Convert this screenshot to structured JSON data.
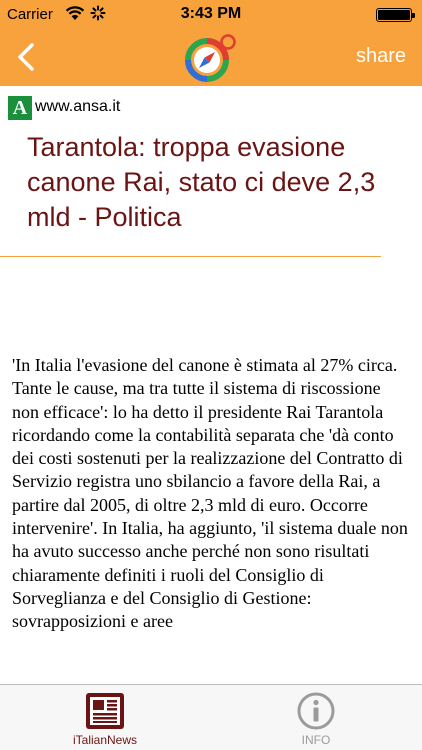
{
  "status_bar": {
    "carrier": "Carrier",
    "time": "3:43 PM"
  },
  "nav": {
    "share_label": "share"
  },
  "source": {
    "mark": "A",
    "url": "www.ansa.it"
  },
  "article": {
    "title": "Tarantola: troppa evasione canone Rai, stato ci deve 2,3 mld - Politica",
    "body": " 'In Italia l'evasione del canone è stimata al 27% circa. Tante le cause, ma tra tutte il sistema di riscossione non efficace': lo ha detto il presidente Rai Tarantola ricordando come la contabilità separata che 'dà conto dei costi sostenuti per la realizzazione del Contratto di Servizio registra uno sbilancio a favore della Rai, a partire dal 2005, di oltre 2,3 mld di euro. Occorre intervenire'. In Italia, ha aggiunto, 'il sistema duale non ha avuto successo anche perché non sono risultati chiaramente definiti i ruoli del Consiglio di Sorveglianza e del Consiglio di Gestione: sovrapposizioni e aree"
  },
  "tabbar": {
    "tabs": [
      {
        "label": "iTalianNews",
        "icon": "newspaper-icon",
        "selected": true
      },
      {
        "label": "INFO",
        "icon": "info-icon",
        "selected": false
      }
    ]
  },
  "colors": {
    "header": "#f7a23c",
    "title": "#6b1414",
    "source_mark": "#1a8f3c",
    "tab_selected": "#6b1414",
    "tab_unselected": "#9b9b9b"
  }
}
